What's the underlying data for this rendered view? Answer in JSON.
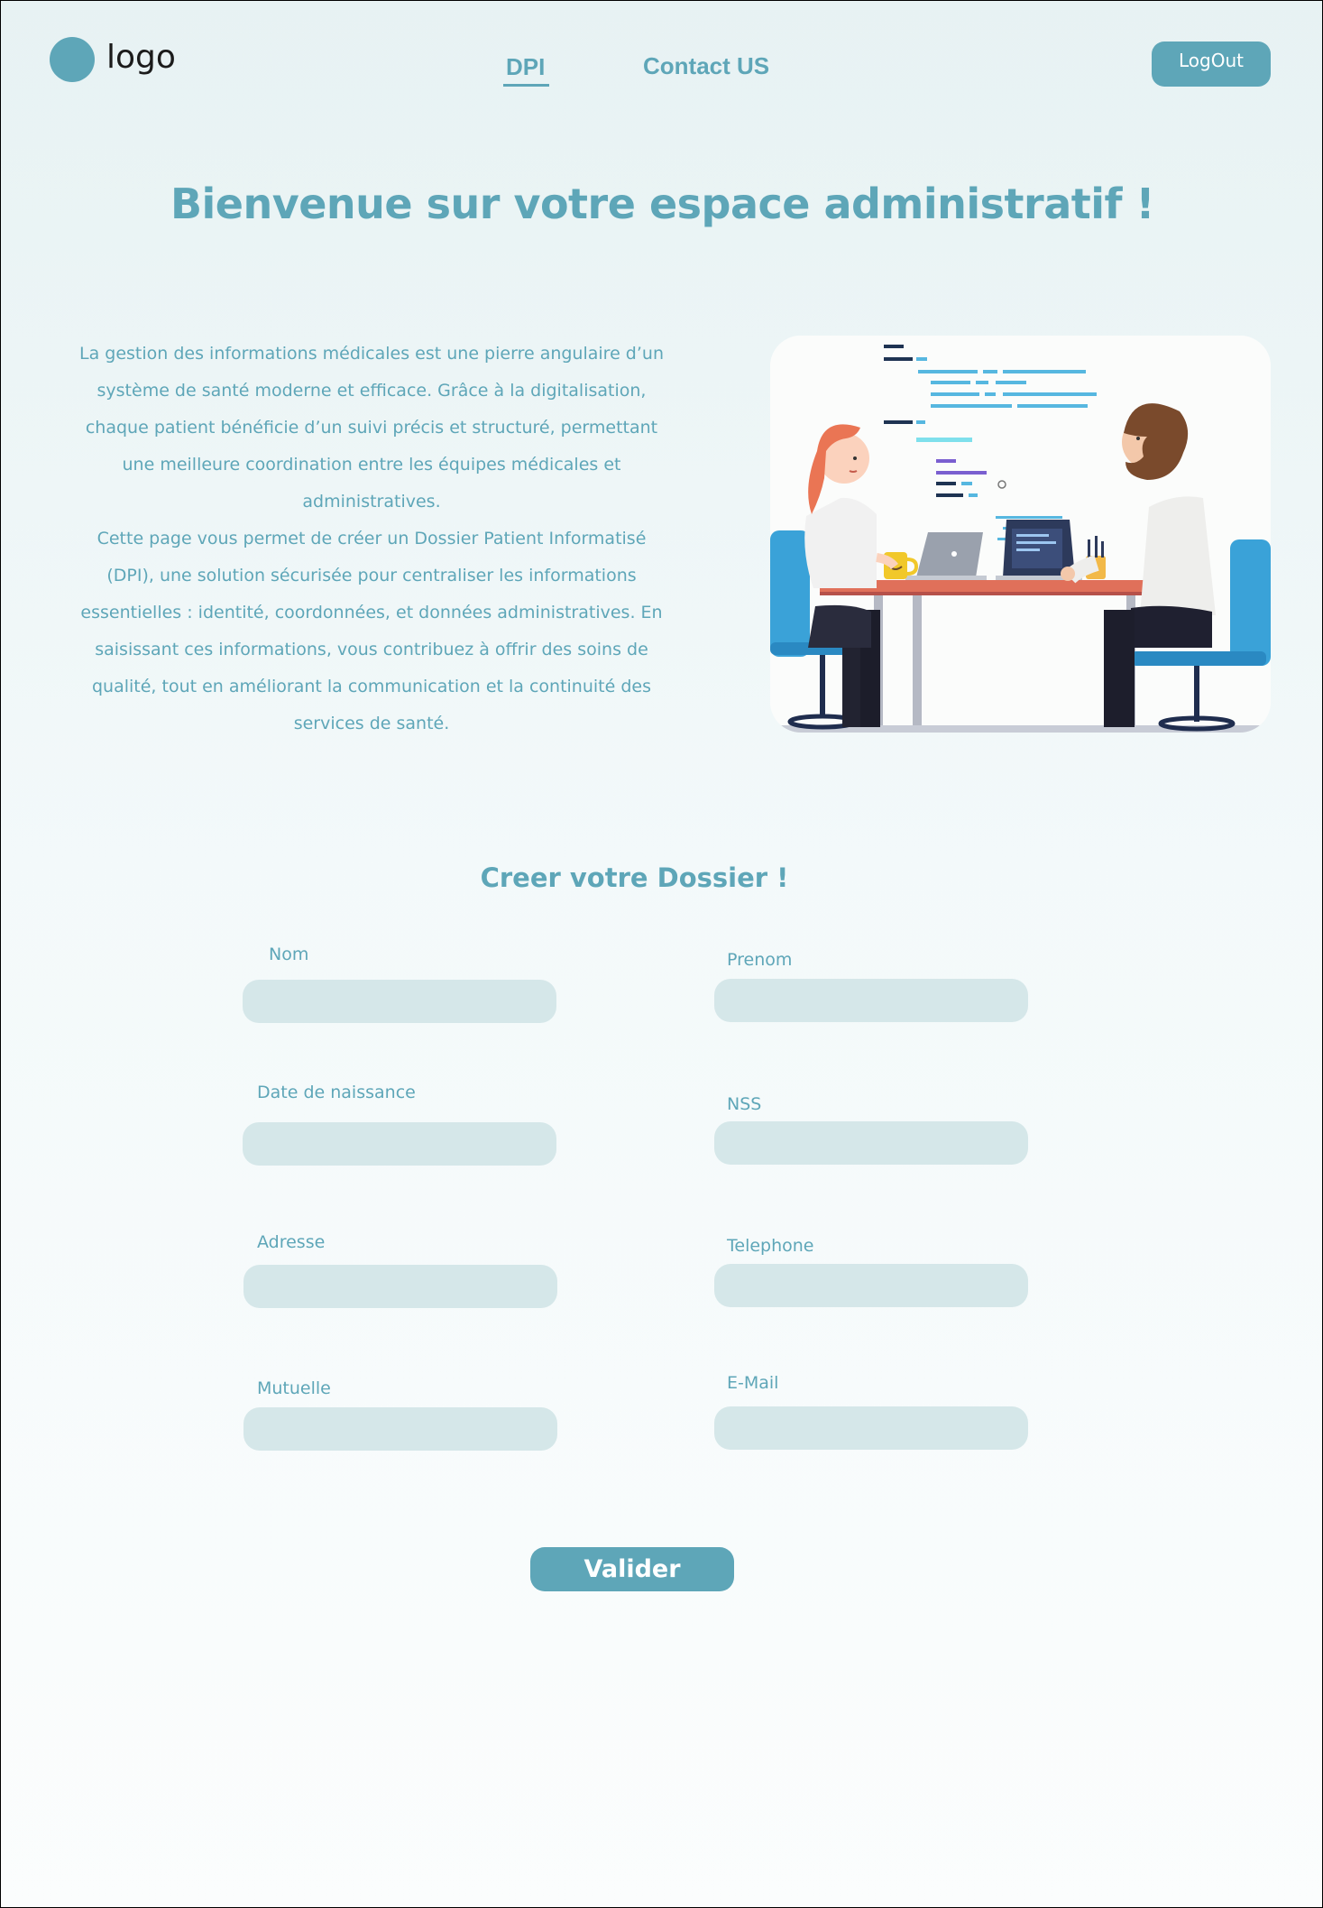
{
  "header": {
    "logo_text": "logo",
    "nav": {
      "dpi": "DPI",
      "contact": "Contact US"
    },
    "logout_label": "LogOut"
  },
  "hero": {
    "title": "Bienvenue sur votre espace administratif !",
    "paragraph1": "La gestion des informations médicales est une pierre angulaire d’un système de santé moderne et efficace. Grâce à la digitalisation, chaque patient bénéficie d’un suivi précis et structuré, permettant une meilleure coordination entre les équipes médicales et administratives.",
    "paragraph2": "Cette page vous permet de créer un Dossier Patient Informatisé (DPI), une solution sécurisée pour centraliser les informations essentielles : identité, coordonnées, et données administratives. En saisissant ces informations, vous contribuez à offrir des soins de qualité, tout en améliorant la communication et la continuité des services de santé."
  },
  "form": {
    "title": "Creer votre Dossier !",
    "fields": {
      "nom": {
        "label": "Nom",
        "value": ""
      },
      "prenom": {
        "label": "Prenom",
        "value": ""
      },
      "date_naissance": {
        "label": "Date de naissance",
        "value": ""
      },
      "nss": {
        "label": "NSS",
        "value": ""
      },
      "adresse": {
        "label": "Adresse",
        "value": ""
      },
      "telephone": {
        "label": "Telephone",
        "value": ""
      },
      "mutuelle": {
        "label": "Mutuelle",
        "value": ""
      },
      "email": {
        "label": "E-Mail",
        "value": ""
      }
    },
    "submit_label": "Valider"
  },
  "colors": {
    "accent": "#5ea6b8",
    "input_bg": "#d5e7e9",
    "background": "#eef6f7"
  },
  "icons": {
    "logo": "circle-logo-icon"
  }
}
